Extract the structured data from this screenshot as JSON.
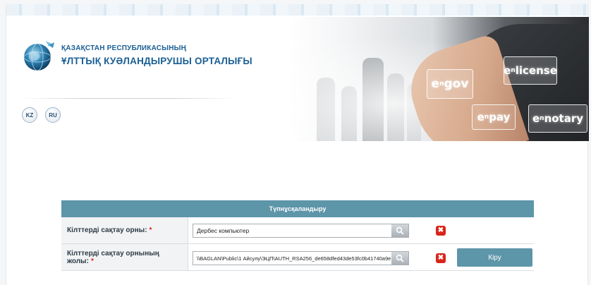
{
  "header": {
    "org_line1": "ҚАЗАҚСТАН РЕСПУБЛИКАСЫНЫҢ",
    "org_line2": "ҰЛТТЫҚ КУӘЛАНДЫРУШЫ ОРТАЛЫҒЫ",
    "languages": [
      "KZ",
      "RU"
    ]
  },
  "banner": {
    "egov": "gov",
    "elicense": "license",
    "epay": "pay",
    "enotary": "notary",
    "e_prefix": "e",
    "n_sub": "n"
  },
  "auth_form": {
    "title": "Түпнұсқаландыру",
    "storage_label": "Кілттерді сақтау орны:",
    "storage_value": "Дербес компьютер",
    "path_label": "Кілттерді сақтау орнының жолы:",
    "path_value": "\\\\BAGLAN\\Public\\1 Айсулу\\ЭЦП\\AUTH_RSA256_de658dfed43de53fc0b41740a9e",
    "required_mark": "*",
    "clear_symbol": "✖",
    "login_label": "Кіру"
  },
  "colors": {
    "accent": "#5d95a9",
    "brand_text": "#1a5f94",
    "danger": "#d9251c"
  },
  "icons": {
    "search": "search-icon",
    "clear": "close-icon",
    "logo": "globe-logo-icon"
  }
}
